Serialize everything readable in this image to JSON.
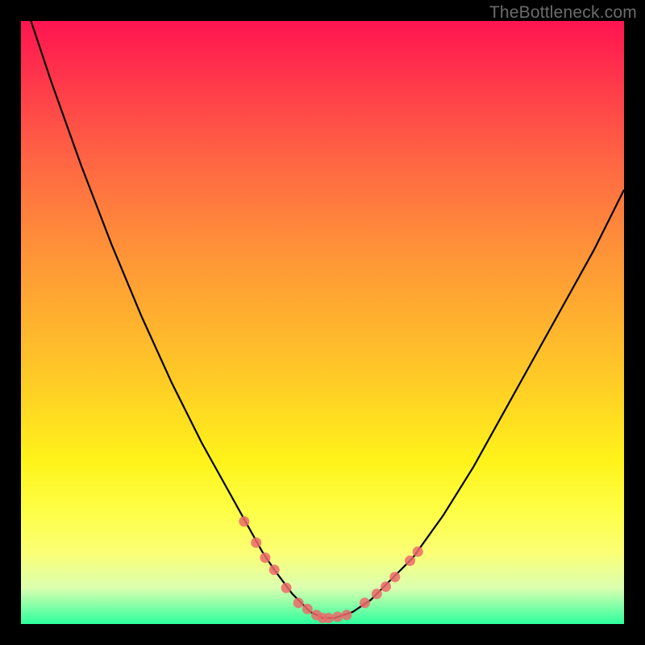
{
  "watermark": "TheBottleneck.com",
  "chart_data": {
    "type": "line",
    "title": "",
    "xlabel": "",
    "ylabel": "",
    "xlim": [
      0,
      100
    ],
    "ylim": [
      0,
      100
    ],
    "series": [
      {
        "name": "bottleneck-curve",
        "x": [
          0,
          5,
          10,
          15,
          20,
          25,
          30,
          35,
          40,
          42,
          45,
          48,
          50,
          52,
          55,
          58,
          60,
          65,
          70,
          75,
          80,
          85,
          90,
          95,
          100
        ],
        "y": [
          105,
          90,
          76,
          63,
          51,
          40,
          30,
          21,
          12,
          9,
          5,
          2,
          1,
          1,
          2,
          4,
          6,
          11,
          18,
          26,
          35,
          44,
          53,
          62,
          72
        ]
      }
    ],
    "markers": {
      "name": "pink-dots",
      "color": "#ec6a6a",
      "x": [
        37,
        39,
        40.5,
        42,
        44,
        46,
        47.5,
        49,
        50,
        51,
        52.5,
        54,
        57,
        59,
        60.5,
        62,
        64.5,
        65.8
      ],
      "y": [
        17,
        13.5,
        11,
        9,
        6,
        3.5,
        2.5,
        1.5,
        1,
        1,
        1.2,
        1.5,
        3.5,
        5,
        6.2,
        7.8,
        10.5,
        12
      ]
    },
    "gradient_stops": [
      {
        "offset": 0.0,
        "color": "#ff1450"
      },
      {
        "offset": 0.25,
        "color": "#ff6b42"
      },
      {
        "offset": 0.5,
        "color": "#ffb22e"
      },
      {
        "offset": 0.73,
        "color": "#fff31a"
      },
      {
        "offset": 0.94,
        "color": "#dbffb0"
      },
      {
        "offset": 1.0,
        "color": "#2dff9d"
      }
    ]
  }
}
